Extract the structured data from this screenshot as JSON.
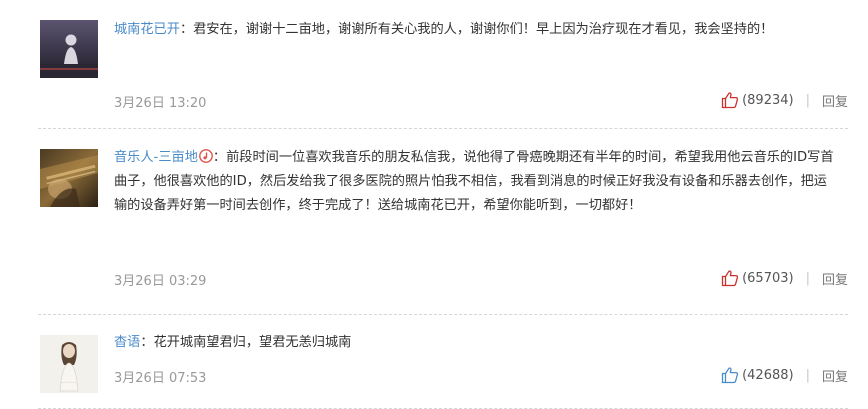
{
  "comments": [
    {
      "username": "城南花已开",
      "colon": "：",
      "text": "君安在，谢谢十二亩地，谢谢所有关心我的人，谢谢你们！早上因为治疗现在才看见，我会坚持的！",
      "time": "3月26日 13:20",
      "likes": "(89234)",
      "liked": true,
      "sep": "|",
      "reply": "回复"
    },
    {
      "username": "音乐人-三亩地",
      "colon": "：",
      "text": "前段时间一位喜欢我音乐的朋友私信我，说他得了骨癌晚期还有半年的时间，希望我用他云音乐的ID写首曲子，他很喜欢他的ID，然后发给我了很多医院的照片怕我不相信，我看到消息的时候正好我没有设备和乐器去创作，把运输的设备弄好第一时间去创作，终于完成了！送给城南花已开，希望你能听到，一切都好！",
      "time": "3月26日 03:29",
      "likes": "(65703)",
      "liked": true,
      "sep": "|",
      "reply": "回复"
    },
    {
      "username": "杳语",
      "colon": "：",
      "text": "花开城南望君归，望君无恙归城南",
      "time": "3月26日 07:53",
      "likes": "(42688)",
      "liked": false,
      "sep": "|",
      "reply": "回复"
    }
  ],
  "colors": {
    "username": "#4a8cc9",
    "liked": "#c9302c",
    "unliked": "#4a8cc9",
    "meta": "#999999"
  },
  "icons": {
    "like": "thumbs-up-icon",
    "badge": "music-note-badge-icon"
  }
}
